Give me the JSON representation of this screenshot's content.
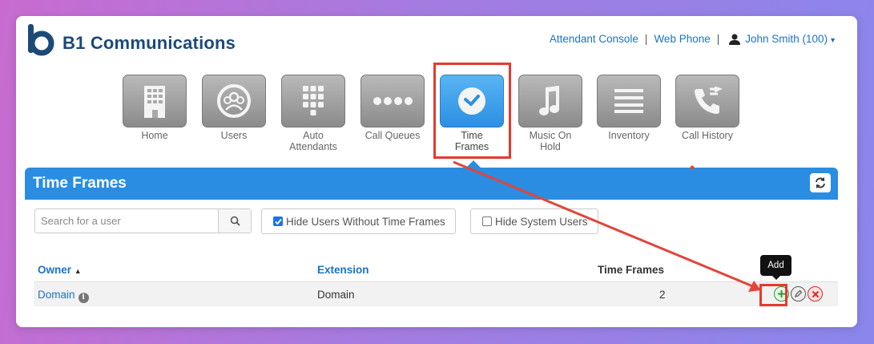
{
  "brand": {
    "name": "B1 Communications"
  },
  "toplinks": {
    "attendant_console": "Attendant Console",
    "web_phone": "Web Phone",
    "separator": "|",
    "user": "John Smith (100)"
  },
  "nav": [
    {
      "label": "Home",
      "icon": "building-icon"
    },
    {
      "label": "Users",
      "icon": "users-icon"
    },
    {
      "label": "Auto Attendants",
      "icon": "keypad-icon"
    },
    {
      "label": "Call Queues",
      "icon": "dots-icon"
    },
    {
      "label": "Time Frames",
      "icon": "clock-icon",
      "active": true
    },
    {
      "label": "Music On Hold",
      "icon": "music-note-icon"
    },
    {
      "label": "Inventory",
      "icon": "list-icon"
    },
    {
      "label": "Call History",
      "icon": "phone-history-icon"
    }
  ],
  "page": {
    "title": "Time Frames"
  },
  "search": {
    "placeholder": "Search for a user"
  },
  "filters": {
    "hide_without": {
      "label": "Hide Users Without Time Frames",
      "checked": true
    },
    "hide_system": {
      "label": "Hide System Users",
      "checked": false
    }
  },
  "table": {
    "columns": {
      "owner": "Owner",
      "extension": "Extension",
      "time_frames": "Time Frames"
    },
    "rows": [
      {
        "owner": "Domain",
        "extension": "Domain",
        "time_frames": "2"
      }
    ]
  },
  "tooltip": {
    "add": "Add"
  },
  "colors": {
    "accent": "#2a8de2",
    "highlight": "#e43a2e",
    "brand": "#1c4a78"
  }
}
